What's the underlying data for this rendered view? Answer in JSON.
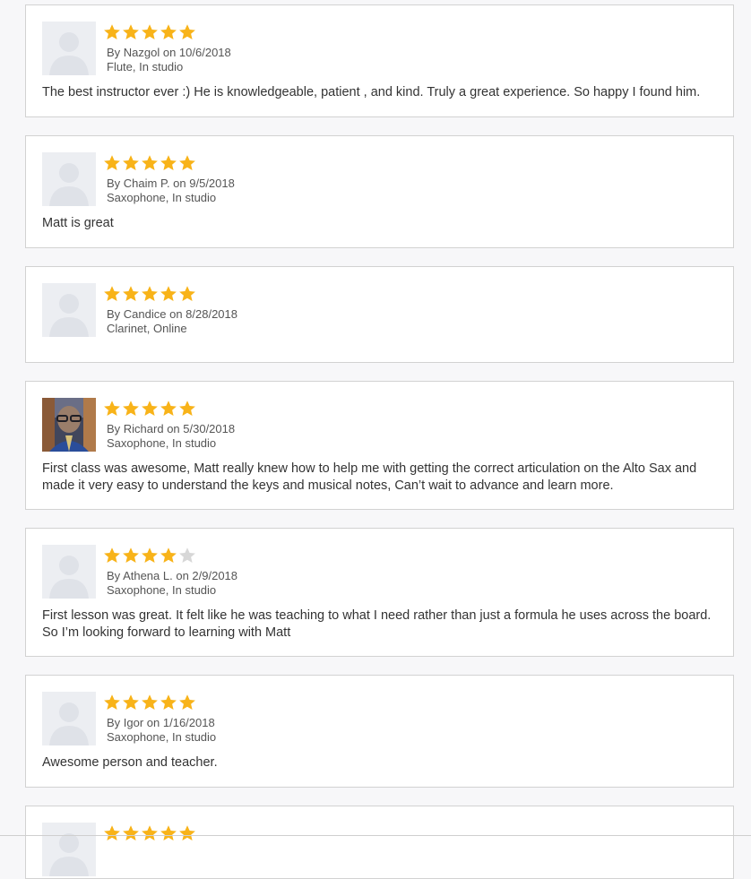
{
  "colors": {
    "star_filled": "#f8b319",
    "star_empty": "#d7d7d7",
    "card_border": "#d2d2d2"
  },
  "reviews": [
    {
      "rating": 5,
      "byline": "By Nazgol on 10/6/2018",
      "lesson": "Flute, In studio",
      "text": "The best instructor ever :) He is knowledgeable, patient , and kind. Truly a great experience. So happy I found him.",
      "avatar": "placeholder-avatar-icon"
    },
    {
      "rating": 5,
      "byline": "By Chaim P. on 9/5/2018",
      "lesson": "Saxophone, In studio",
      "text": "Matt is great",
      "avatar": "placeholder-avatar-icon"
    },
    {
      "rating": 5,
      "byline": "By Candice on 8/28/2018",
      "lesson": "Clarinet, Online",
      "text": "",
      "avatar": "placeholder-avatar-icon"
    },
    {
      "rating": 5,
      "byline": "By Richard on 5/30/2018",
      "lesson": "Saxophone, In studio",
      "text": "First class was awesome, Matt really knew how to help me with getting the correct articulation on the Alto Sax and made it very easy to understand the keys and musical notes, Can’t wait to advance and learn more.",
      "avatar": "user-photo"
    },
    {
      "rating": 4,
      "byline": "By Athena L. on 2/9/2018",
      "lesson": "Saxophone, In studio",
      "text": "First lesson was great. It felt like he was teaching to what I need rather than just a formula he uses across the board. So I’m looking forward to learning with Matt",
      "avatar": "placeholder-avatar-icon"
    },
    {
      "rating": 5,
      "byline": "By Igor on 1/16/2018",
      "lesson": "Saxophone, In studio",
      "text": "Awesome person and teacher.",
      "avatar": "placeholder-avatar-icon"
    },
    {
      "rating": 5,
      "byline": "",
      "lesson": "",
      "text": "",
      "avatar": "placeholder-avatar-icon"
    }
  ]
}
